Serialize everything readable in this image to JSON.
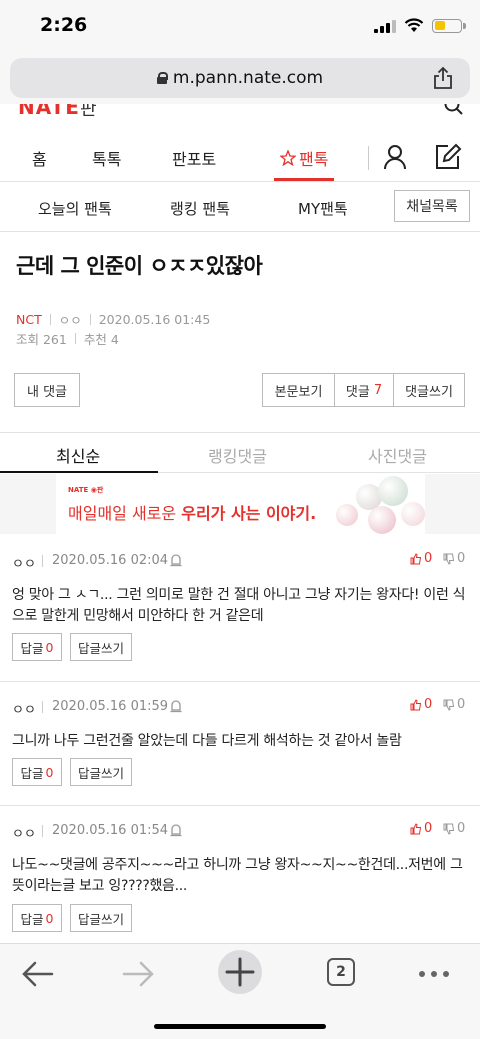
{
  "status_bar": {
    "time": "2:26"
  },
  "browser": {
    "url": "m.pann.nate.com",
    "tab_count": "2"
  },
  "site_header": {
    "logo": "NATE",
    "logo_sub": "판"
  },
  "main_nav": {
    "items": [
      "홈",
      "톡톡",
      "판포토",
      "팬톡"
    ],
    "active": "팬톡"
  },
  "sub_nav": {
    "items": [
      "오늘의 팬톡",
      "랭킹 팬톡",
      "MY팬톡"
    ],
    "channel_button": "채널목록"
  },
  "post": {
    "title": "근데 그 인준이 ㅇㅈㅈ있잖아",
    "channel": "NCT",
    "author": "ㅇㅇ",
    "datetime": "2020.05.16 01:45",
    "views_label": "조회 261",
    "recommend_label": "추천 4"
  },
  "actions": {
    "my_comments": "내 댓글",
    "view_body": "본문보기",
    "comments_label": "댓글",
    "comments_count": "7",
    "write_comment": "댓글쓰기"
  },
  "comment_tabs": [
    "최신순",
    "랭킹댓글",
    "사진댓글"
  ],
  "banner": {
    "logo": "NATE ◉판",
    "text_plain": "매일매일 새로운 ",
    "text_bold": "우리가 사는 이야기."
  },
  "comments": [
    {
      "author": "ㅇㅇ",
      "datetime": "2020.05.16 02:04",
      "up": "0",
      "down": "0",
      "text": "엉 맞아 그 ㅅㄱ... 그런 의미로 말한 건 절대 아니고 그냥 자기는 왕자다! 이런 식으로 말한게 민망해서 미안하다 한 거 같은데",
      "reply_label": "답글",
      "reply_count": "0",
      "write_reply": "답글쓰기"
    },
    {
      "author": "ㅇㅇ",
      "datetime": "2020.05.16 01:59",
      "up": "0",
      "down": "0",
      "text": "그니까 나두 그런건줄 알았는데 다들 다르게 해석하는 것 같아서 놀람",
      "reply_label": "답글",
      "reply_count": "0",
      "write_reply": "답글쓰기"
    },
    {
      "author": "ㅇㅇ",
      "datetime": "2020.05.16 01:54",
      "up": "0",
      "down": "0",
      "text": "나도~~댓글에 공주지~~~라고 하니까 그냥 왕자~~지~~한건데...저번에 그뜻이라는글 보고 잉????했음...",
      "reply_label": "답글",
      "reply_count": "0",
      "write_reply": "답글쓰기"
    }
  ],
  "colors": {
    "accent": "#e4312b",
    "toolbar_bg": "#f7f7f7"
  }
}
